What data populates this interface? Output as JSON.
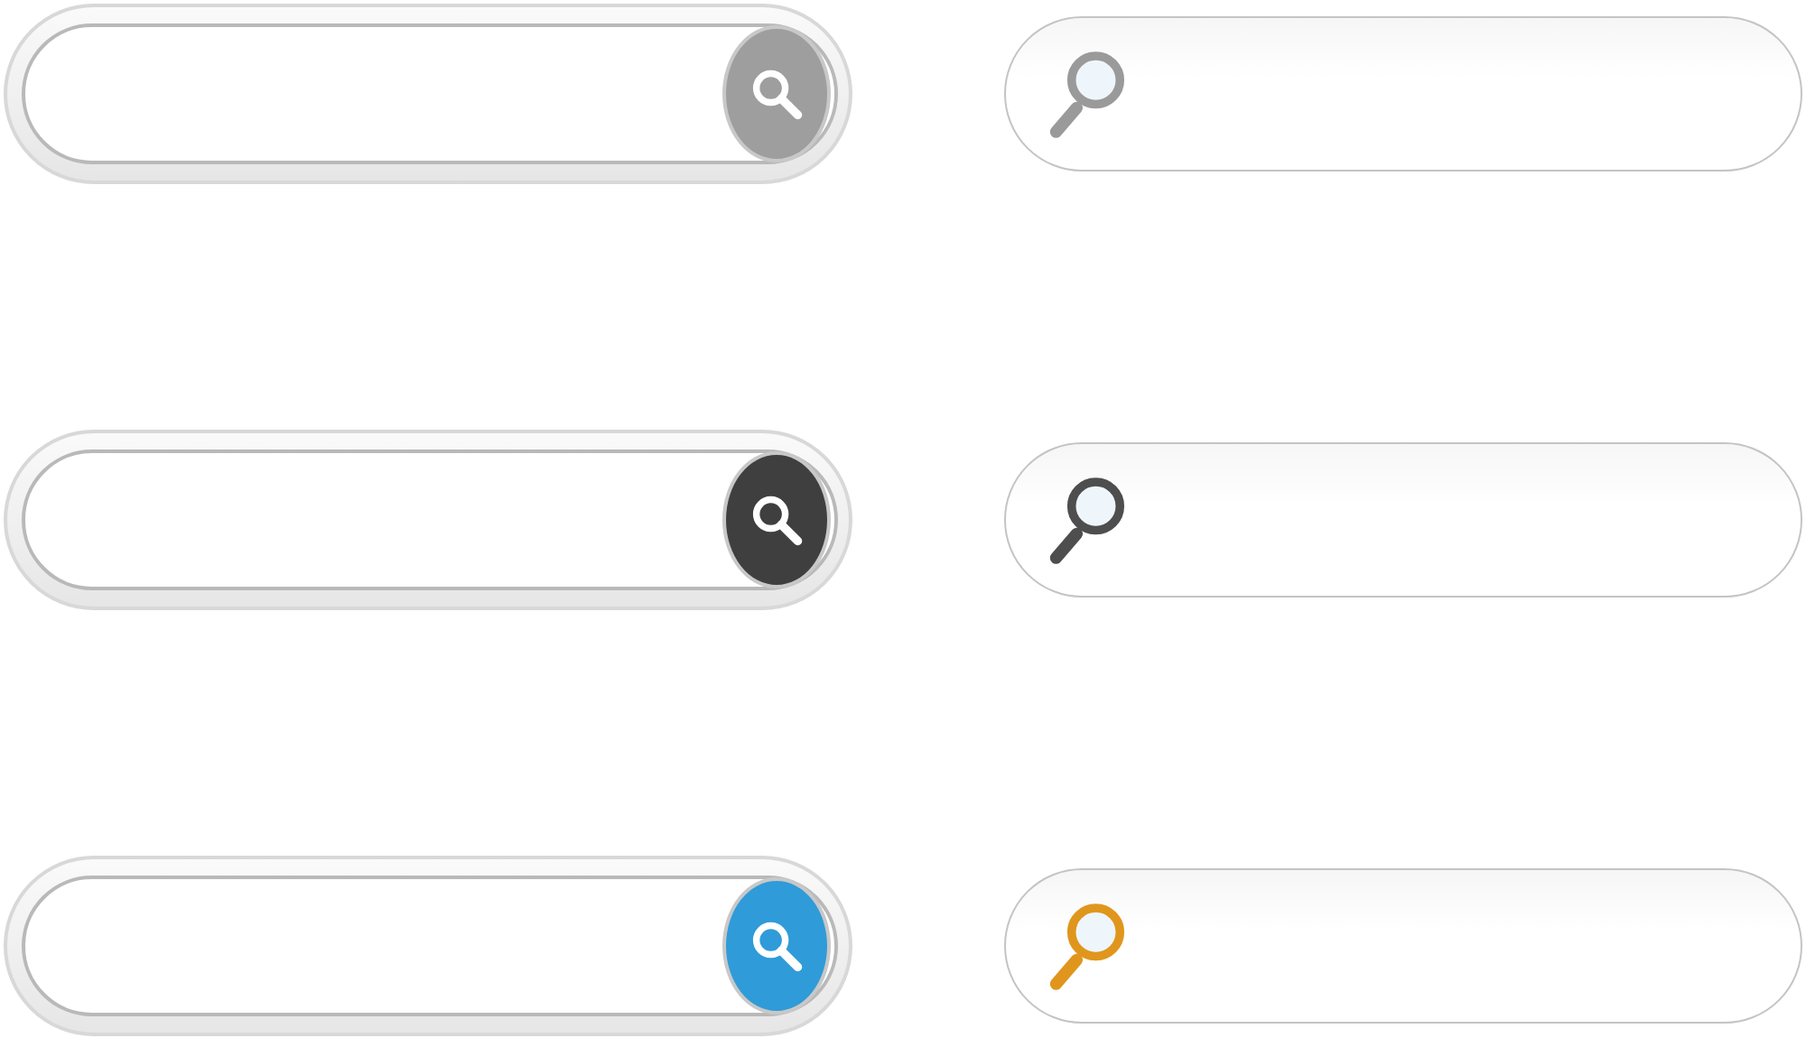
{
  "search_bars": [
    {
      "kind": "button",
      "color": "#9e9e9e"
    },
    {
      "kind": "button",
      "color": "#3f3f3f"
    },
    {
      "kind": "button",
      "color": "#2f9bd9"
    },
    {
      "kind": "icon",
      "color": "#9a9a9a"
    },
    {
      "kind": "icon",
      "color": "#4e4e4e"
    },
    {
      "kind": "icon",
      "color": "#e0961c"
    }
  ]
}
